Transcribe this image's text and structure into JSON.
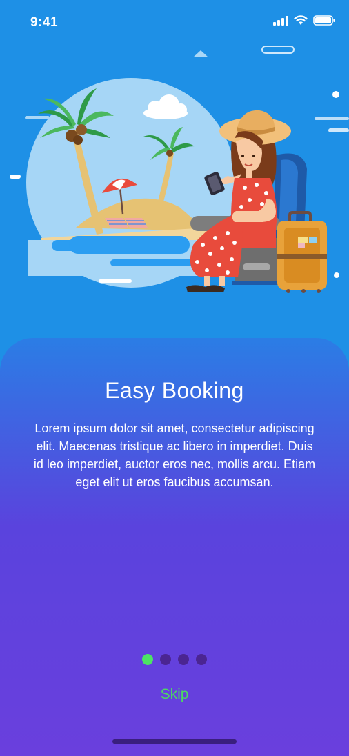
{
  "status_bar": {
    "time": "9:41"
  },
  "onboarding": {
    "title": "Easy Booking",
    "body": "Lorem ipsum dolor sit amet, consectetur adipiscing elit. Maecenas tristique ac libero in imperdiet. Duis id leo imperdiet, auctor eros nec, mollis arcu. Etiam eget elit ut eros faucibus accumsan.",
    "pages_total": 4,
    "current_page": 1,
    "skip_label": "Skip"
  },
  "colors": {
    "background": "#1E90E6",
    "gradient_end": "#6A3FDD",
    "active_dot": "#4CE364",
    "inactive_dot": "#4B2592",
    "skip": "#4CD862"
  }
}
